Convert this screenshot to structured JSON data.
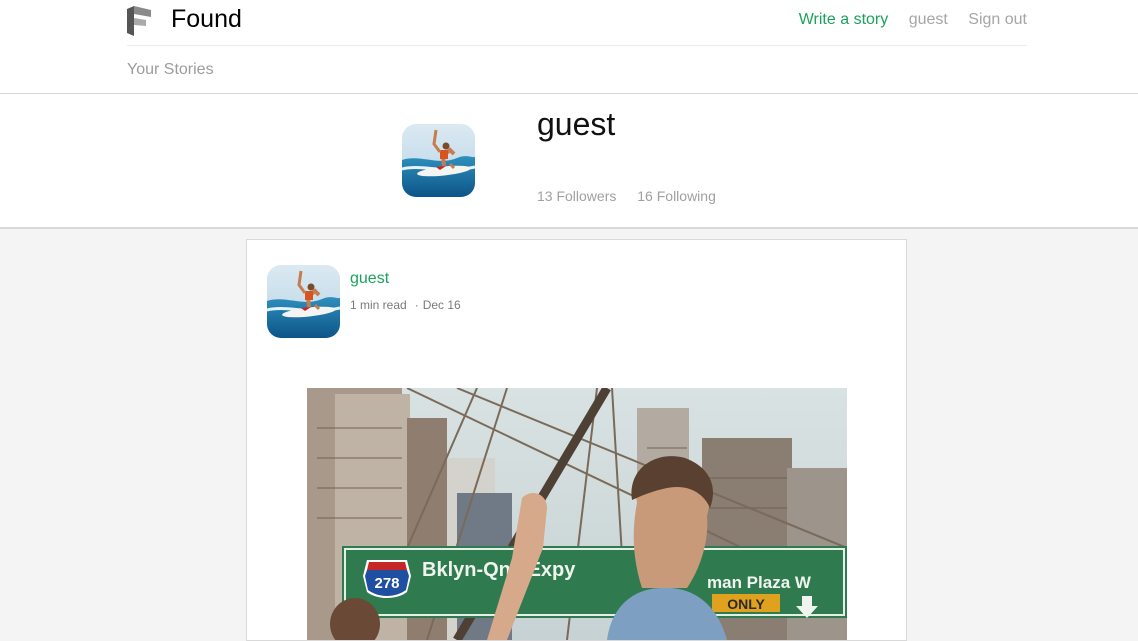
{
  "brand": {
    "name": "Found",
    "logo_icon": "found-logo-icon"
  },
  "nav": {
    "write_story": "Write a story",
    "user": "guest",
    "sign_out": "Sign out"
  },
  "subnav": {
    "your_stories": "Your Stories"
  },
  "profile": {
    "name": "guest",
    "followers": "13 Followers",
    "following": "16 Following"
  },
  "story": {
    "author": "guest",
    "read_time": "1 min read",
    "date": "Dec 16"
  },
  "photo": {
    "shield_number": "278",
    "sign_left": "Bklyn-Qns Expy",
    "sign_right": "man Plaza W",
    "only": "ONLY"
  },
  "colors": {
    "accent": "#1aa35b",
    "muted": "#a6a6a6",
    "background": "#f4f4f4"
  }
}
